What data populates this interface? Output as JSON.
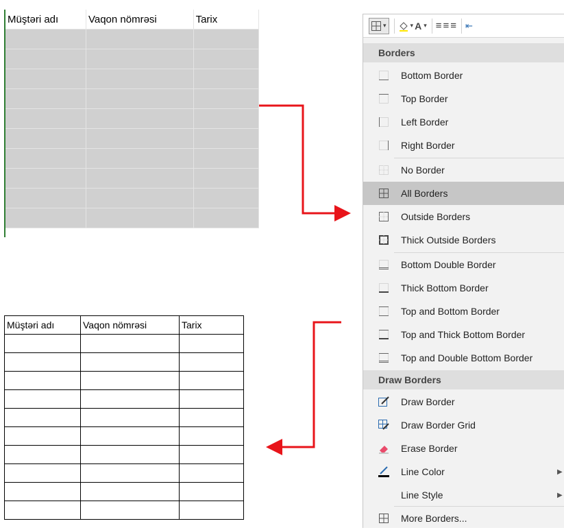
{
  "table": {
    "headers": [
      "Müştəri adı",
      "Vaqon nömrəsi",
      "Tarix"
    ]
  },
  "menu": {
    "sections": {
      "borders": "Borders",
      "draw_borders": "Draw Borders"
    },
    "items": [
      {
        "label": "Bottom Border",
        "icon": "bottom-border-icon"
      },
      {
        "label": "Top Border",
        "icon": "top-border-icon"
      },
      {
        "label": "Left Border",
        "icon": "left-border-icon"
      },
      {
        "label": "Right Border",
        "icon": "right-border-icon"
      },
      {
        "label": "No Border",
        "icon": "no-border-icon"
      },
      {
        "label": "All Borders",
        "icon": "all-borders-icon",
        "selected": true
      },
      {
        "label": "Outside Borders",
        "icon": "outside-borders-icon"
      },
      {
        "label": "Thick Outside Borders",
        "icon": "thick-outside-borders-icon"
      },
      {
        "label": "Bottom Double Border",
        "icon": "bottom-double-border-icon"
      },
      {
        "label": "Thick Bottom Border",
        "icon": "thick-bottom-border-icon"
      },
      {
        "label": "Top and Bottom Border",
        "icon": "top-and-bottom-border-icon"
      },
      {
        "label": "Top and Thick Bottom Border",
        "icon": "top-and-thick-bottom-border-icon"
      },
      {
        "label": "Top and Double Bottom Border",
        "icon": "top-and-double-bottom-border-icon"
      },
      {
        "label": "Draw Border",
        "icon": "draw-border-icon"
      },
      {
        "label": "Draw Border Grid",
        "icon": "draw-border-grid-icon"
      },
      {
        "label": "Erase Border",
        "icon": "eraser-icon"
      },
      {
        "label": "Line Color",
        "icon": "line-color-icon",
        "submenu": true
      },
      {
        "label": "Line Style",
        "icon": "",
        "submenu": true
      },
      {
        "label": "More Borders...",
        "icon": "more-borders-icon"
      }
    ]
  },
  "colors": {
    "arrow": "#e8141a",
    "selected": "#c6c6c6",
    "sheet_fill": "#d0d0d0",
    "gridline_green": "#2e7d32"
  }
}
